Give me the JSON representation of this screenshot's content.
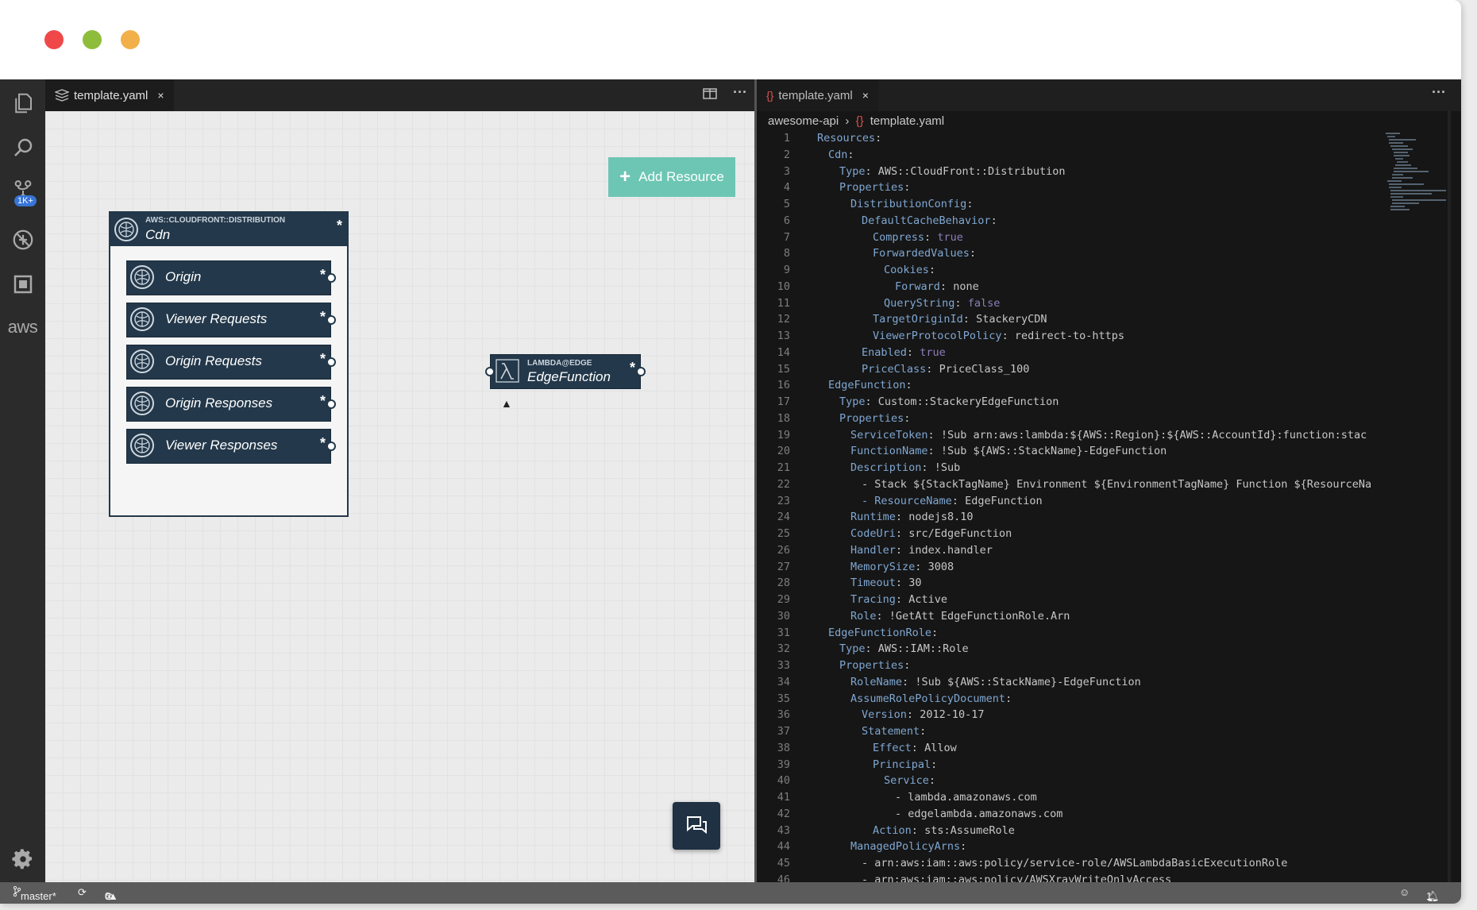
{
  "left_tab": {
    "label": "template.yaml",
    "close": "×"
  },
  "right_tab": {
    "label": "template.yaml",
    "close": "×"
  },
  "toolbar": {
    "split_icon": "split-editor-icon",
    "more": "···"
  },
  "canvas": {
    "add_resource": "Add Resource",
    "add_icon": "+",
    "cdn": {
      "type": "AWS::CLOUDFRONT::DISTRIBUTION",
      "name": "Cdn",
      "star": "*",
      "events": [
        "Origin",
        "Viewer Requests",
        "Origin Requests",
        "Origin Responses",
        "Viewer Responses"
      ]
    },
    "edge": {
      "type": "LAMBDA@EDGE",
      "name": "EdgeFunction",
      "star": "*"
    }
  },
  "breadcrumb": {
    "project": "awesome-api",
    "sep": "›",
    "file_icon": "{}",
    "file": "template.yaml"
  },
  "code_lines": [
    {
      "n": "1",
      "i": 1,
      "k": "Resources",
      "v": ""
    },
    {
      "n": "2",
      "i": 2,
      "k": "Cdn",
      "v": ""
    },
    {
      "n": "3",
      "i": 3,
      "k": "Type",
      "v": "AWS::CloudFront::Distribution"
    },
    {
      "n": "4",
      "i": 3,
      "k": "Properties",
      "v": ""
    },
    {
      "n": "5",
      "i": 4,
      "k": "DistributionConfig",
      "v": ""
    },
    {
      "n": "6",
      "i": 5,
      "k": "DefaultCacheBehavior",
      "v": ""
    },
    {
      "n": "7",
      "i": 6,
      "k": "Compress",
      "v": "true"
    },
    {
      "n": "8",
      "i": 6,
      "k": "ForwardedValues",
      "v": ""
    },
    {
      "n": "9",
      "i": 7,
      "k": "Cookies",
      "v": ""
    },
    {
      "n": "10",
      "i": 8,
      "k": "Forward",
      "v": "none"
    },
    {
      "n": "11",
      "i": 7,
      "k": "QueryString",
      "v": "false"
    },
    {
      "n": "12",
      "i": 6,
      "k": "TargetOriginId",
      "v": "StackeryCDN"
    },
    {
      "n": "13",
      "i": 6,
      "k": "ViewerProtocolPolicy",
      "v": "redirect-to-https"
    },
    {
      "n": "14",
      "i": 5,
      "k": "Enabled",
      "v": "true"
    },
    {
      "n": "15",
      "i": 5,
      "k": "PriceClass",
      "v": "PriceClass_100"
    },
    {
      "n": "16",
      "i": 2,
      "k": "EdgeFunction",
      "v": ""
    },
    {
      "n": "17",
      "i": 3,
      "k": "Type",
      "v": "Custom::StackeryEdgeFunction"
    },
    {
      "n": "18",
      "i": 3,
      "k": "Properties",
      "v": ""
    },
    {
      "n": "19",
      "i": 4,
      "k": "ServiceToken",
      "v": "!Sub arn:aws:lambda:${AWS::Region}:${AWS::AccountId}:function:stac"
    },
    {
      "n": "20",
      "i": 4,
      "k": "FunctionName",
      "v": "!Sub ${AWS::StackName}-EdgeFunction"
    },
    {
      "n": "21",
      "i": 4,
      "k": "Description",
      "v": "!Sub"
    },
    {
      "n": "22",
      "i": 5,
      "k": "",
      "v": "- Stack ${StackTagName} Environment ${EnvironmentTagName} Function ${ResourceNa"
    },
    {
      "n": "23",
      "i": 5,
      "k": "- ResourceName",
      "v": "EdgeFunction"
    },
    {
      "n": "24",
      "i": 4,
      "k": "Runtime",
      "v": "nodejs8.10"
    },
    {
      "n": "25",
      "i": 4,
      "k": "CodeUri",
      "v": "src/EdgeFunction"
    },
    {
      "n": "26",
      "i": 4,
      "k": "Handler",
      "v": "index.handler"
    },
    {
      "n": "27",
      "i": 4,
      "k": "MemorySize",
      "v": "3008"
    },
    {
      "n": "28",
      "i": 4,
      "k": "Timeout",
      "v": "30"
    },
    {
      "n": "29",
      "i": 4,
      "k": "Tracing",
      "v": "Active"
    },
    {
      "n": "30",
      "i": 4,
      "k": "Role",
      "v": "!GetAtt EdgeFunctionRole.Arn"
    },
    {
      "n": "31",
      "i": 2,
      "k": "EdgeFunctionRole",
      "v": ""
    },
    {
      "n": "32",
      "i": 3,
      "k": "Type",
      "v": "AWS::IAM::Role"
    },
    {
      "n": "33",
      "i": 3,
      "k": "Properties",
      "v": ""
    },
    {
      "n": "34",
      "i": 4,
      "k": "RoleName",
      "v": "!Sub ${AWS::StackName}-EdgeFunction"
    },
    {
      "n": "35",
      "i": 4,
      "k": "AssumeRolePolicyDocument",
      "v": ""
    },
    {
      "n": "36",
      "i": 5,
      "k": "Version",
      "v": "2012-10-17"
    },
    {
      "n": "37",
      "i": 5,
      "k": "Statement",
      "v": ""
    },
    {
      "n": "38",
      "i": 6,
      "k": "Effect",
      "v": "Allow"
    },
    {
      "n": "39",
      "i": 6,
      "k": "Principal",
      "v": ""
    },
    {
      "n": "40",
      "i": 7,
      "k": "Service",
      "v": ""
    },
    {
      "n": "41",
      "i": 8,
      "k": "",
      "v": "- lambda.amazonaws.com"
    },
    {
      "n": "42",
      "i": 8,
      "k": "",
      "v": "- edgelambda.amazonaws.com"
    },
    {
      "n": "43",
      "i": 6,
      "k": "Action",
      "v": "sts:AssumeRole"
    },
    {
      "n": "44",
      "i": 4,
      "k": "ManagedPolicyArns",
      "v": ""
    },
    {
      "n": "45",
      "i": 5,
      "k": "",
      "v": "- arn:aws:iam::aws:policy/service-role/AWSLambdaBasicExecutionRole"
    },
    {
      "n": "46",
      "i": 5,
      "k": "",
      "v": "- arn:aws:iam::aws:policy/AWSXrayWriteOnlyAccess"
    }
  ],
  "activity_bar": {
    "icons": [
      "explorer-icon",
      "search-icon",
      "source-control-icon",
      "debug-icon",
      "extensions-icon",
      "aws-icon",
      "settings-gear-icon"
    ],
    "badge": "1K+",
    "aws_label": "aws"
  },
  "status": {
    "branch": "master*",
    "errors": "0",
    "warnings": "0",
    "notifications": "1"
  },
  "colors": {
    "node": "#23384a",
    "add_button": "#6dc6b4",
    "editor_bg": "#161616"
  }
}
